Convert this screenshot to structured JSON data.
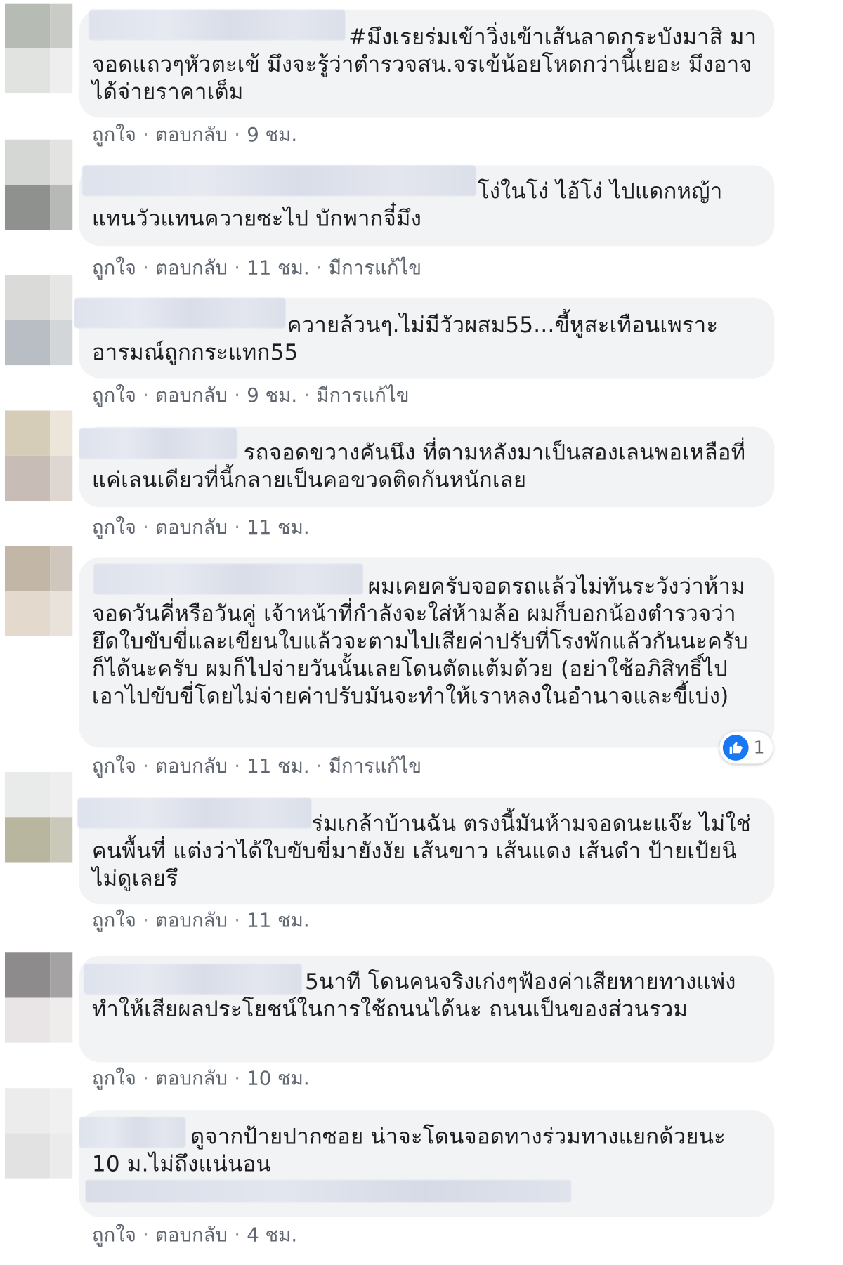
{
  "labels": {
    "like": "ถูกใจ",
    "reply": "ตอบกลับ",
    "separator": "·"
  },
  "comments": [
    {
      "text": "#มึงเรยร่มเข้าวิ่งเข้าเส้นลาดกระบังมาสิ มาจอดแถวๆหัวตะเข้ มึงจะรู้ว่าตำรวจสน.จรเข้น้อยโหดกว่านี้เยอะ มึงอาจได้จ่ายราคาเต็ม",
      "time": "9 ชม.",
      "edited": ""
    },
    {
      "text": "โง่ในโง่ ไอ้โง่ ไปแดกหญ้าแทนวัวแทนควายซะไป บักพากจี๋มึง",
      "time": "11 ชม.",
      "edited": "มีการแก้ไข"
    },
    {
      "text": "ควายล้วนๆ.ไม่มีวัวผสม55...ขี้หูสะเทือนเพราะอารมณ์ถูกกระแทก55",
      "time": "9 ชม.",
      "edited": "มีการแก้ไข"
    },
    {
      "text": "รถจอดขวางคันนึง ที่ตามหลังมาเป็นสองเลนพอเหลือที่แค่เลนเดียวที่นี้กลายเป็นคอขวดติดกันหนักเลย",
      "time": "11 ชม.",
      "edited": ""
    },
    {
      "text": "ผมเคยครับจอดรถแล้วไม่ทันระวังว่าห้ามจอดวันคี่หรือวันคู่ เจ้าหน้าที่กำลังจะใส่ห้ามล้อ ผมก็บอกน้องตำรวจว่ายึดใบขับขี่และเขียนใบแล้วจะตามไปเสียค่าปรับที่โรงพักแล้วกันนะครับ ก็ได้นะครับ ผมก็ไปจ่ายวันนั้นเลยโดนตัดแต้มด้วย (อย่าใช้อภิสิทธิ์ไปเอาไปขับขี่โดยไม่จ่ายค่าปรับมันจะทำให้เราหลงในอำนาจและขี้เบ่ง)",
      "time": "11 ชม.",
      "edited": "มีการแก้ไข",
      "reaction_count": "1"
    },
    {
      "text": "ร่มเกล้าบ้านฉัน ตรงนี้มันห้ามจอดนะแจ๊ะ ไม่ใช่คนพื้นที่ แต่งว่าได้ใบขับขี่มายังงัย เส้นขาว เส้นแดง เส้นดำ ป้ายเป้ยนิไม่ดูเลยรึ",
      "time": "11 ชม.",
      "edited": ""
    },
    {
      "text": "5นาที โดนคนจริงเก่งๆฟ้องค่าเสียหายทางแพ่งทำให้เสียผลประโยชน์ในการใช้ถนนได้นะ ถนนเป็นของส่วนรวม",
      "time": "10 ชม.",
      "edited": ""
    },
    {
      "text": "ดูจากป้ายปากซอย น่าจะโดนจอดทางร่วมทางแยกด้วยนะ 10 ม.ไม่ถึงแน่นอน",
      "time": "4 ชม.",
      "edited": ""
    }
  ],
  "colors": {
    "bubble": "#f2f3f5",
    "text": "#1c1e21",
    "meta": "#616770",
    "like_blue": "#1877f2"
  },
  "icons": {
    "reaction": "thumbs-up-icon"
  }
}
